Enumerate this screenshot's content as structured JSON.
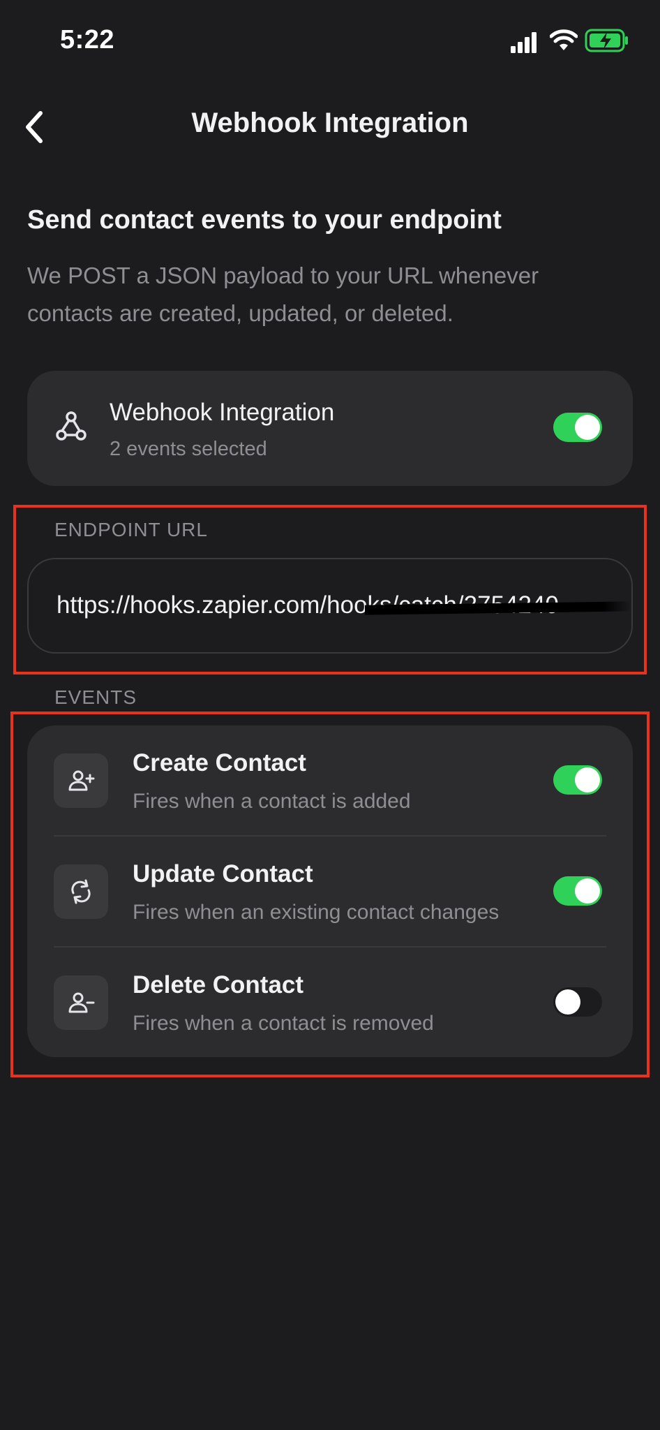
{
  "status_bar": {
    "time": "5:22"
  },
  "nav": {
    "title": "Webhook Integration"
  },
  "intro": {
    "title": "Send contact events to your endpoint",
    "description": "We POST a JSON payload to your URL whenever contacts are created, updated, or deleted."
  },
  "integration": {
    "title": "Webhook Integration",
    "subtitle": "2 events selected",
    "enabled": true,
    "icon": "webhook-icon"
  },
  "endpoint": {
    "label": "ENDPOINT URL",
    "value": "https://hooks.zapier.com/hooks/catch/2754240"
  },
  "events": {
    "label": "EVENTS",
    "items": [
      {
        "title": "Create Contact",
        "description": "Fires when a contact is added",
        "enabled": true,
        "icon": "person-add-icon"
      },
      {
        "title": "Update Contact",
        "description": "Fires when an existing contact changes",
        "enabled": true,
        "icon": "refresh-icon"
      },
      {
        "title": "Delete Contact",
        "description": "Fires when a contact is removed",
        "enabled": false,
        "icon": "person-remove-icon"
      }
    ]
  },
  "colors": {
    "background": "#1c1c1e",
    "card": "#2c2c2e",
    "toggle_on": "#30d158",
    "highlight": "#e8321c",
    "secondary_text": "#8e8e93"
  }
}
